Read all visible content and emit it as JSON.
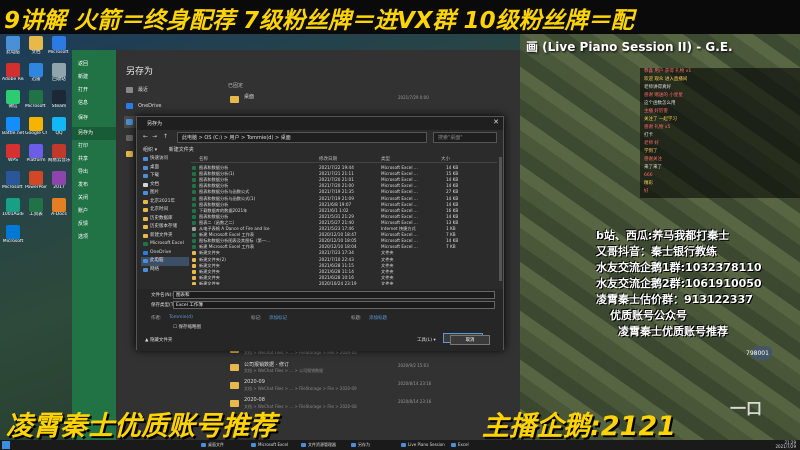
{
  "top_banner": "9讲解 火箭＝终身配荐 7级粉丝牌＝进VX群 10级粉丝牌＝配",
  "stream_title": "画 (Live Piano Session II) - G.E.",
  "desktop_icons": [
    {
      "label": "此电脑",
      "color": "#4a90d9"
    },
    {
      "label": "文档",
      "color": "#e7b94b"
    },
    {
      "label": "Microsoft Edge",
      "color": "#2c7be5"
    },
    {
      "label": "Adobe Reader XI",
      "color": "#d32f2f"
    },
    {
      "label": "迅雷",
      "color": "#2e86de"
    },
    {
      "label": "回收站",
      "color": "#90a4ae"
    },
    {
      "label": "微信",
      "color": "#2ecc71"
    },
    {
      "label": "Microsoft Excel",
      "color": "#217346"
    },
    {
      "label": "Steam",
      "color": "#1b2838"
    },
    {
      "label": "Battle.net",
      "color": "#148eff"
    },
    {
      "label": "Google Chrome",
      "color": "#f4b400"
    },
    {
      "label": "QQ",
      "color": "#12b7f5"
    },
    {
      "label": "WPS",
      "color": "#d63031"
    },
    {
      "label": "Platform",
      "color": "#6c5ce7"
    },
    {
      "label": "网易云音乐",
      "color": "#c0392b"
    },
    {
      "label": "Microsoft Word",
      "color": "#2b579a"
    },
    {
      "label": "PowerPoint",
      "color": "#d24726"
    },
    {
      "label": "2017",
      "color": "#8e44ad"
    },
    {
      "label": "1001Audio",
      "color": "#16a085"
    },
    {
      "label": "工资表",
      "color": "#217346"
    },
    {
      "label": "A-Docs",
      "color": "#e67e22"
    },
    {
      "label": "Microsoft",
      "color": "#0078d7"
    }
  ],
  "excel_left": {
    "items": [
      "返回",
      "新建",
      "打开",
      "信息",
      "保存",
      "另存为",
      "打印",
      "共享",
      "导出",
      "发布",
      "关闭",
      "账户",
      "反馈",
      "选项"
    ],
    "selected": 5
  },
  "save_as": {
    "title": "另存为",
    "locations": [
      {
        "label": "最近",
        "color": "#888888"
      },
      {
        "label": "OneDrive",
        "color": "#2c7be5"
      },
      {
        "label": "此电脑",
        "color": "#4a90d9"
      },
      {
        "label": "添加位置",
        "color": "#666666"
      },
      {
        "label": "浏览",
        "color": "#e7b94b"
      }
    ],
    "right_heading": "已固定",
    "recent_items": [
      {
        "name": "桌面",
        "path": "",
        "date": "2021/7/29 0:00"
      },
      {
        "name": "2020-10",
        "path": "文档 > WeChat Files > ... > FileStorage > File > 2020-10",
        "date": "2020/10/1 15:28"
      },
      {
        "name": "公司报销数据 - 修订",
        "path": "文档 > WeChat Files > ... > 公司报销数据",
        "date": "2020/9/2 15:03"
      },
      {
        "name": "2020-09",
        "path": "文档 > WeChat Files > ... > FileStorage > File > 2020-09",
        "date": "2020/8/14 23:16"
      },
      {
        "name": "2020-08",
        "path": "文档 > WeChat Files > ... > FileStorage > File > 2020-08",
        "date": "2020/8/14 23:16"
      }
    ]
  },
  "dialog": {
    "title": "另存为",
    "address": "此电脑 > OS (C:) > 用户 > Tommie(d) > 桌面",
    "search_placeholder": "搜索\"桌面\"",
    "toolbar": [
      "组织 ▾",
      "新建文件夹"
    ],
    "nav_items": [
      {
        "label": "快速访问",
        "color": "#4a90d9",
        "sel": false
      },
      {
        "label": "桌面",
        "color": "#4a90d9",
        "sel": false
      },
      {
        "label": "下载",
        "color": "#4a90d9",
        "sel": false
      },
      {
        "label": "文档",
        "color": "#cfd8dc",
        "sel": false
      },
      {
        "label": "图片",
        "color": "#4a90d9",
        "sel": false
      },
      {
        "label": "北京2021年",
        "color": "#e7b94b",
        "sel": false
      },
      {
        "label": "北京时间",
        "color": "#e7b94b",
        "sel": false
      },
      {
        "label": "历史数据库",
        "color": "#e7b94b",
        "sel": false
      },
      {
        "label": "历史版本存储",
        "color": "#e7b94b",
        "sel": false
      },
      {
        "label": "新建文件夹",
        "color": "#e7b94b",
        "sel": false
      },
      {
        "label": "Microsoft Excel",
        "color": "#217346",
        "sel": false
      },
      {
        "label": "OneDrive",
        "color": "#2c7be5",
        "sel": false
      },
      {
        "label": "此电脑",
        "color": "#4a90d9",
        "sel": true
      },
      {
        "label": "网络",
        "color": "#4a90d9",
        "sel": false
      }
    ],
    "columns": [
      "名称",
      "修改日期",
      "类型",
      "大小"
    ],
    "files": [
      {
        "name": "图表和数据分析",
        "date": "2021/7/22 19:44",
        "type": "Microsoft Excel ...",
        "size": "14 KB",
        "color": "#217346"
      },
      {
        "name": "图表和数据分析(1)",
        "date": "2021/7/21 21:11",
        "type": "Microsoft Excel ...",
        "size": "15 KB",
        "color": "#217346"
      },
      {
        "name": "图表和数据分析",
        "date": "2021/7/20 21:01",
        "type": "Microsoft Excel ...",
        "size": "14 KB",
        "color": "#217346"
      },
      {
        "name": "图表和数据分析",
        "date": "2021/7/20 21:00",
        "type": "Microsoft Excel ...",
        "size": "14 KB",
        "color": "#217346"
      },
      {
        "name": "图表和数据分析与函数公式",
        "date": "2021/7/19 21:35",
        "type": "Microsoft Excel ...",
        "size": "27 KB",
        "color": "#217346"
      },
      {
        "name": "图表和数据分析与函数公式(1)",
        "date": "2021/7/19 21:09",
        "type": "Microsoft Excel ...",
        "size": "14 KB",
        "color": "#217346"
      },
      {
        "name": "图表和数据分析",
        "date": "2021/6/8 19:07",
        "type": "Microsoft Excel ...",
        "size": "14 KB",
        "color": "#217346"
      },
      {
        "name": "下载数据库的数据2021年",
        "date": "2021/6/1 1:02",
        "type": "Microsoft Excel ...",
        "size": "16 KB",
        "color": "#217346"
      },
      {
        "name": "图表和数据分析",
        "date": "2021/5/31 21:29",
        "type": "Microsoft Excel ...",
        "size": "14 KB",
        "color": "#217346"
      },
      {
        "name": "图表二（函数之二）",
        "date": "2021/5/27 21:40",
        "type": "Microsoft Excel ...",
        "size": "13 KB",
        "color": "#217346"
      },
      {
        "name": "从电子表格 A Dance of Fire and Ice",
        "date": "2021/5/23 17:46",
        "type": "Internet 快捷方式",
        "size": "1 KB",
        "color": "#9e9e9e"
      },
      {
        "name": "新建 Microsoft Excel 工作表",
        "date": "2020/12/10 18:47",
        "type": "Microsoft Excel ...",
        "size": "7 KB",
        "color": "#217346"
      },
      {
        "name": "图标和数据分析图表及其图标（第一...",
        "date": "2020/12/10 18:05",
        "type": "Microsoft Excel ...",
        "size": "14 KB",
        "color": "#217346"
      },
      {
        "name": "新建 Microsoft Excel 工作表",
        "date": "2020/12/10 18:04",
        "type": "Microsoft Excel ...",
        "size": "7 KB",
        "color": "#217346"
      },
      {
        "name": "新建文件夹",
        "date": "2021/7/23 17:34",
        "type": "文件夹",
        "size": "",
        "color": "#e7b94b"
      },
      {
        "name": "新建文件夹(2)",
        "date": "2021/7/10 22:43",
        "type": "文件夹",
        "size": "",
        "color": "#e7b94b"
      },
      {
        "name": "新建文件夹",
        "date": "2021/6/28 11:15",
        "type": "文件夹",
        "size": "",
        "color": "#e7b94b"
      },
      {
        "name": "新建文件夹",
        "date": "2021/6/28 11:14",
        "type": "文件夹",
        "size": "",
        "color": "#e7b94b"
      },
      {
        "name": "新建文件夹",
        "date": "2021/6/28 10:16",
        "type": "文件夹",
        "size": "",
        "color": "#e7b94b"
      },
      {
        "name": "新建文件夹",
        "date": "2020/10/24 23:19",
        "type": "文件夹",
        "size": "",
        "color": "#e7b94b"
      }
    ],
    "filename_label": "文件名(N):",
    "filename_value": "图表和",
    "type_label": "保存类型(T):",
    "type_value": "Excel 工作簿",
    "authors_label": "作者:",
    "authors_value": "Tommie(d)",
    "tags_label": "标记:",
    "tags_value": "添加标记",
    "title_label": "标题:",
    "title_value": "添加标题",
    "thumb_label": "保存缩略图",
    "hide_folders": "▲ 隐藏文件夹",
    "tools": "工具(L) ▾",
    "save": "保存(S)",
    "cancel": "取消"
  },
  "chat": [
    {
      "text": "恭喜 用户 获得 礼物 x1",
      "c": "r"
    },
    {
      "text": "欢迎 观众 进入直播间",
      "c": "y"
    },
    {
      "text": "老师讲得真好",
      "c": "w"
    },
    {
      "text": "感谢 赠送的 小星星",
      "c": "r"
    },
    {
      "text": "这个函数怎么用",
      "c": "w"
    },
    {
      "text": "主播 好厉害",
      "c": "r"
    },
    {
      "text": "关注了 一起学习",
      "c": "y"
    },
    {
      "text": "感谢 礼物 x5",
      "c": "r"
    },
    {
      "text": "打卡",
      "c": "w"
    },
    {
      "text": "老师 好",
      "c": "r"
    },
    {
      "text": "学到了",
      "c": "y"
    },
    {
      "text": "感谢关注",
      "c": "r"
    },
    {
      "text": "来了来了",
      "c": "w"
    },
    {
      "text": "666",
      "c": "r"
    },
    {
      "text": "精彩",
      "c": "y"
    },
    {
      "text": "好",
      "c": "r"
    }
  ],
  "promo_lines": [
    "b站、西瓜:养马我都打秦士",
    "又哥抖音：秦士银行教练",
    "水友交流企鹅1群:1032378110",
    "水友交流企鹅2群:1061910050",
    "凌霄秦士估价群：913122337",
    "优质账号公众号",
    "凌霄秦士优质账号推荐"
  ],
  "viewer_count": "798001",
  "watermark": "一口",
  "bottom_banner_left": "凌霄秦士优质账号推荐",
  "bottom_banner_right": "主播企鹅:2121",
  "taskbar": {
    "items": [
      "桌面文件",
      "Microsoft Excel",
      "文件资源管理器",
      "另存为",
      "Live Piano Session",
      "Excel"
    ],
    "clock_time": "21:29",
    "clock_date": "2021/7/29"
  }
}
